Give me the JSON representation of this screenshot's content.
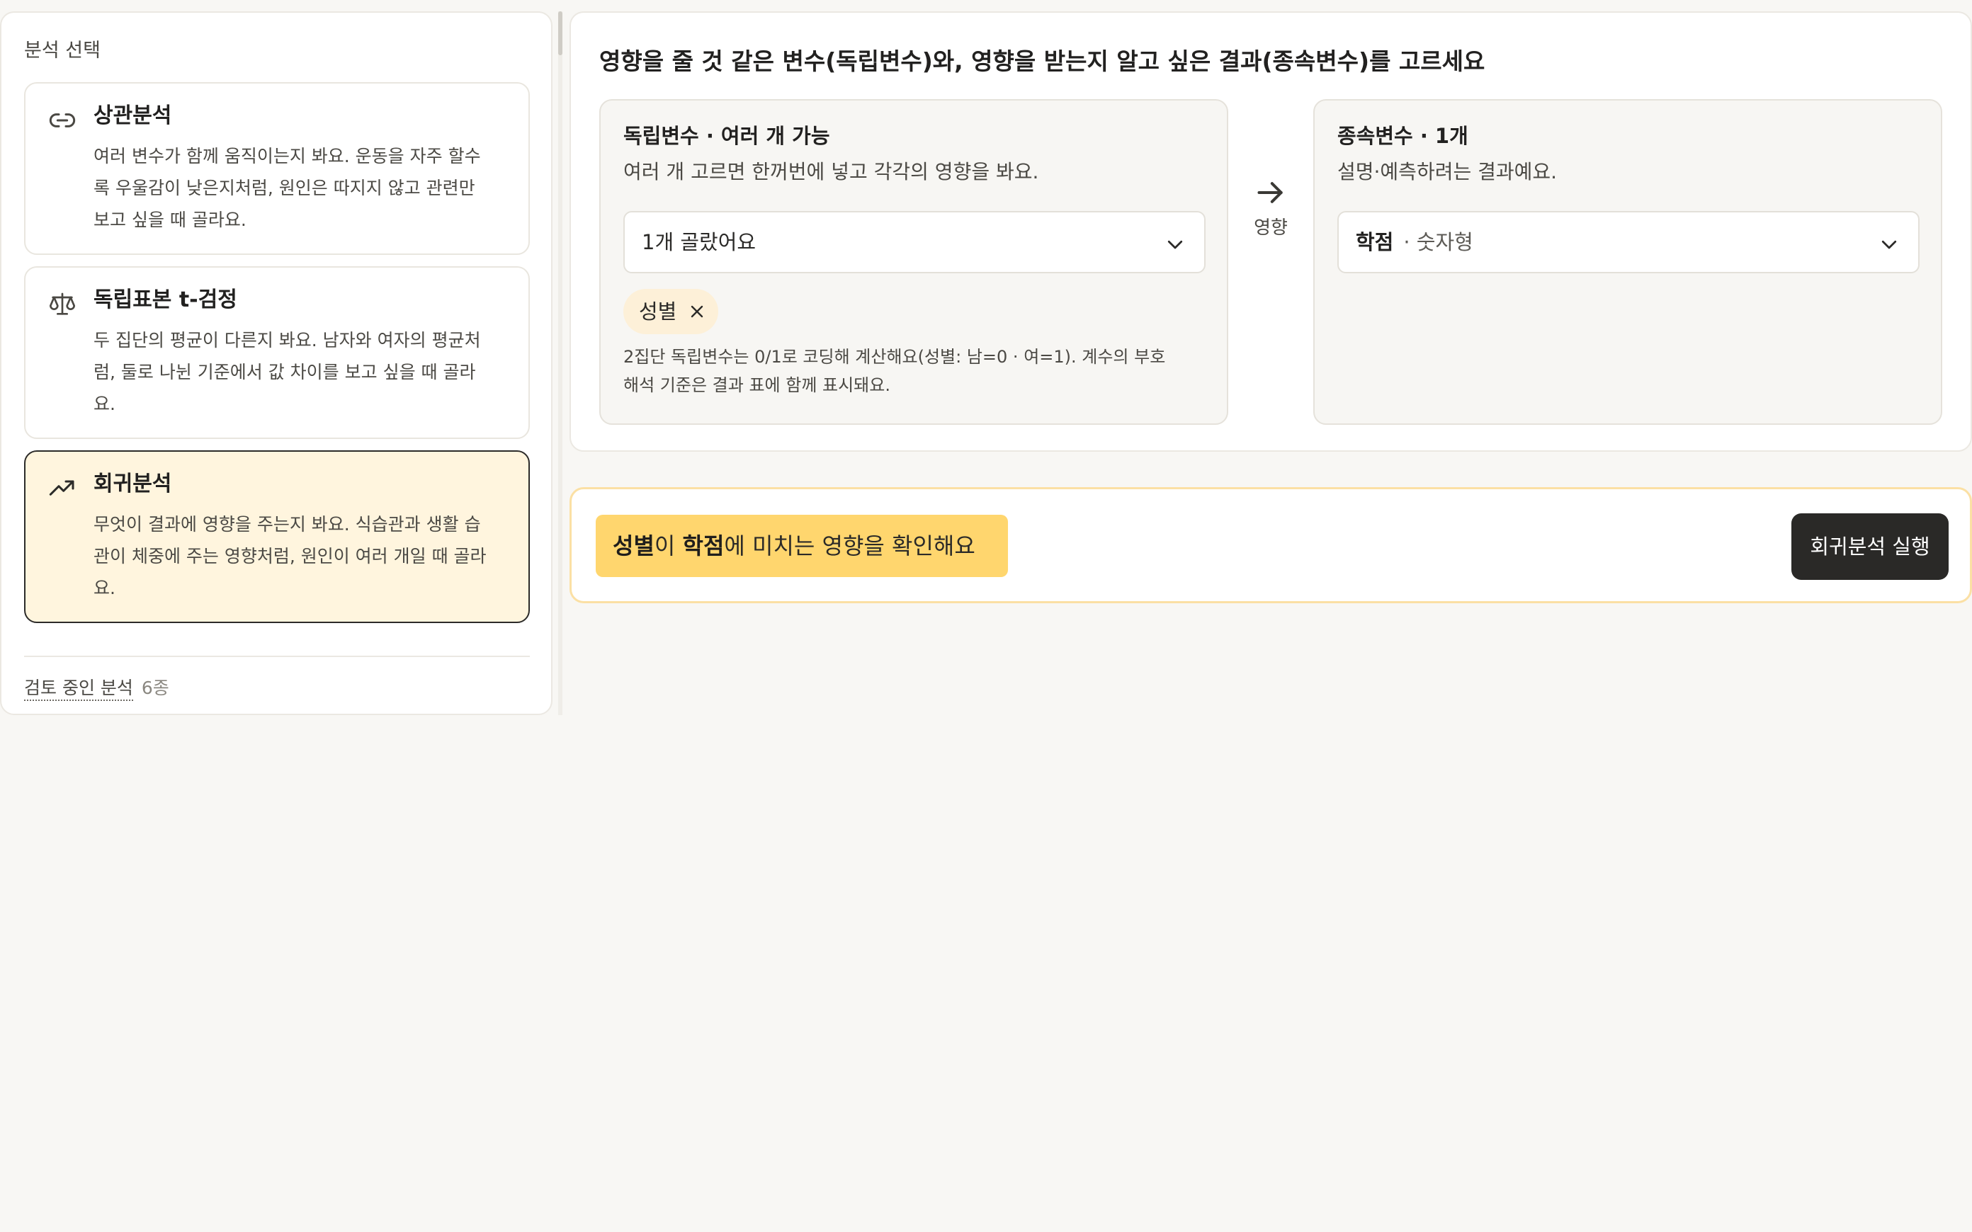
{
  "sidebar": {
    "title": "분석 선택",
    "methods": [
      {
        "icon": "link-icon",
        "name": "상관분석",
        "desc_lines": [
          "여러 변수가 함께 움직이는지 봐요. 운동을 자주 할수",
          "록 우울감이 낮은지처럼, 원인은 따지지 않고 관련만",
          "보고 싶을 때 골라요."
        ]
      },
      {
        "icon": "scale-icon",
        "name": "독립표본 t-검정",
        "desc_lines": [
          "두 집단의 평균이 다른지 봐요. 남자와 여자의 평균처",
          "럼, 둘로 나뉜 기준에서 값 차이를 보고 싶을 때 골라",
          "요."
        ]
      },
      {
        "icon": "trending-up-icon",
        "name": "회귀분석",
        "desc_lines": [
          "무엇이 결과에 영향을 주는지 봐요. 식습관과 생활 습",
          "관이 체중에 주는 영향처럼, 원인이 여러 개일 때 골라",
          "요."
        ],
        "selected": true
      }
    ],
    "review_link": "검토 중인 분석",
    "review_count": "6종"
  },
  "main": {
    "title": "영향을 줄 것 같은 변수(독립변수)와, 영향을 받는지 알고 싶은 결과(종속변수)를 고르세요",
    "independent": {
      "label": "독립변수 · 여러 개 가능",
      "help": "여러 개 고르면 한꺼번에 넣고 각각의 영향을 봐요.",
      "select_value": "1개 골랐어요",
      "chip": "성별",
      "note_lines": [
        "2집단 독립변수는 0/1로 코딩해 계산해요(성별: 남=0 · 여=1). 계수의 부호",
        "해석 기준은 결과 표에 함께 표시돼요."
      ]
    },
    "arrow_label": "영향",
    "dependent": {
      "label": "종속변수 · 1개",
      "help": "설명·예측하려는 결과예요.",
      "select_value": "학점",
      "select_type": "· 숫자형"
    }
  },
  "action": {
    "summary": {
      "iv": "성별",
      "mid": "이 ",
      "dv": "학점",
      "tail": "에 미치는 영향을 확인해요"
    },
    "run_label": "회귀분석 실행"
  },
  "colors": {
    "selected_bg": "#fff5de",
    "accent_yellow": "#ffd66e",
    "chip_bg": "#fdf0d8",
    "button_dark": "#2a2927"
  }
}
